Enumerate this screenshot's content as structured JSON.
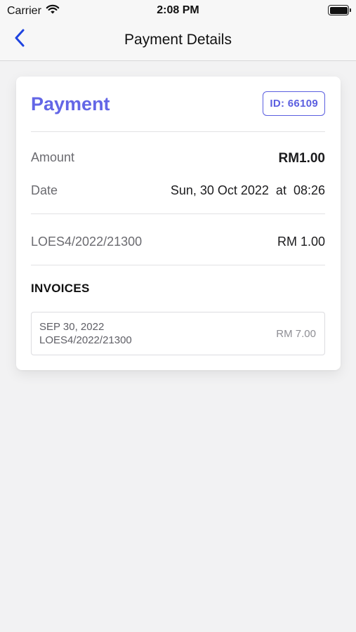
{
  "status_bar": {
    "carrier": "Carrier",
    "time": "2:08 PM",
    "wifi_icon": "wifi-icon",
    "battery_icon": "battery-icon"
  },
  "nav": {
    "title": "Payment Details",
    "back_icon": "chevron-left-icon"
  },
  "payment": {
    "title": "Payment",
    "id_badge": "ID: 66109",
    "amount_label": "Amount",
    "amount_value": "RM1.00",
    "date_label": "Date",
    "date_value": "Sun, 30 Oct 2022  at  08:26",
    "reference": "LOES4/2022/21300",
    "reference_amount": "RM 1.00"
  },
  "invoices": {
    "heading": "INVOICES",
    "items": [
      {
        "date": "SEP 30, 2022",
        "ref": "LOES4/2022/21300",
        "amount": "RM 7.00"
      }
    ]
  },
  "colors": {
    "accent": "#6366e6",
    "back_button": "#1f44e0",
    "background": "#f2f2f3"
  }
}
